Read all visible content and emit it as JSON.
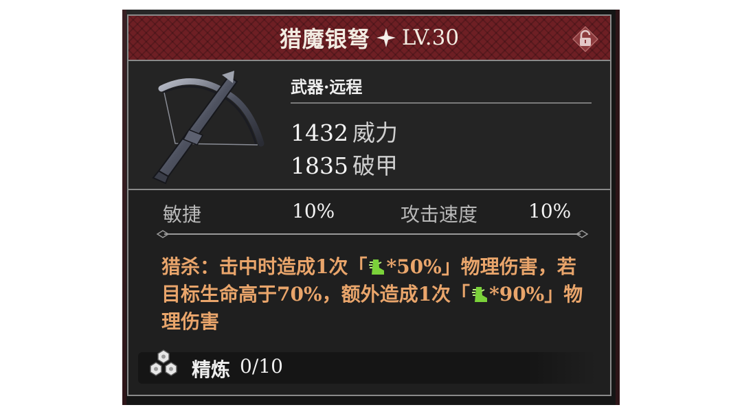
{
  "item": {
    "name": "猎魔银弩",
    "level": "LV.30",
    "type": "武器·远程",
    "stats": [
      {
        "value": "1432",
        "label": "威力"
      },
      {
        "value": "1835",
        "label": "破甲"
      }
    ],
    "attributes": [
      {
        "label": "敏捷",
        "value": "10%"
      },
      {
        "label": "攻击速度",
        "value": "10%"
      }
    ],
    "description": {
      "p1": "猎杀：击中时造成1次「",
      "p2": "*50%」物理伤害，若目标生命高于70%，额外造成1次「",
      "p3": "*90%」物理伤害"
    },
    "refine": {
      "label": "精炼",
      "value": "0/10"
    }
  },
  "icons": {
    "title_star": "four-point-star-icon",
    "lock": "unlocked-padlock-icon",
    "weapon": "crossbow-icon",
    "agility": "green-boot-icon",
    "refine": "hexagon-cluster-icon"
  },
  "colors": {
    "title_bar": "#6e1f24",
    "description_text": "#e9a56b",
    "boot_icon": "#7bd23a"
  }
}
